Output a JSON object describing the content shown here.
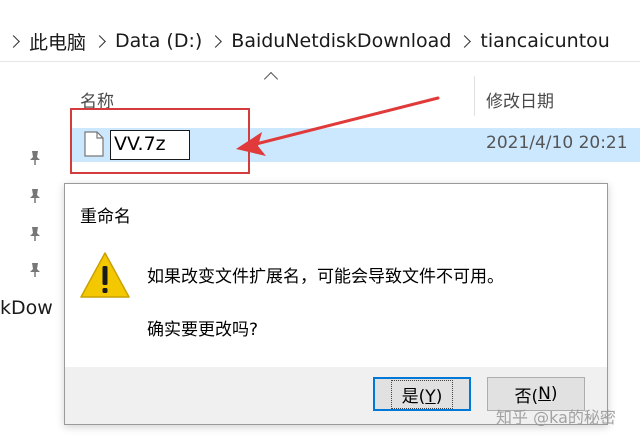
{
  "address_bar": {
    "crumbs": [
      "此电脑",
      "Data (D:)",
      "BaiduNetdiskDownload",
      "tiancaicuntou"
    ]
  },
  "columns": {
    "name": "名称",
    "date_modified": "修改日期"
  },
  "file": {
    "rename_value": "VV.7z",
    "date": "2021/4/10 20:21"
  },
  "nav": {
    "partial_label": "kDow"
  },
  "dialog": {
    "title": "重命名",
    "message": "如果改变文件扩展名，可能会导致文件不可用。",
    "question": "确实要更改吗?",
    "yes_label": "是(",
    "yes_key": "Y",
    "yes_suffix": ")",
    "no_label": "否(",
    "no_key": "N",
    "no_suffix": ")"
  },
  "watermark": "知乎 @ka的秘密",
  "colors": {
    "selection": "#cce8ff",
    "highlight": "#d33c3c",
    "accent": "#0078d7",
    "warning": "#f4c800"
  },
  "icons": [
    "file-icon",
    "pin-icon",
    "warning-icon",
    "chevron-right-icon",
    "sort-up-icon",
    "red-arrow-annotation"
  ]
}
